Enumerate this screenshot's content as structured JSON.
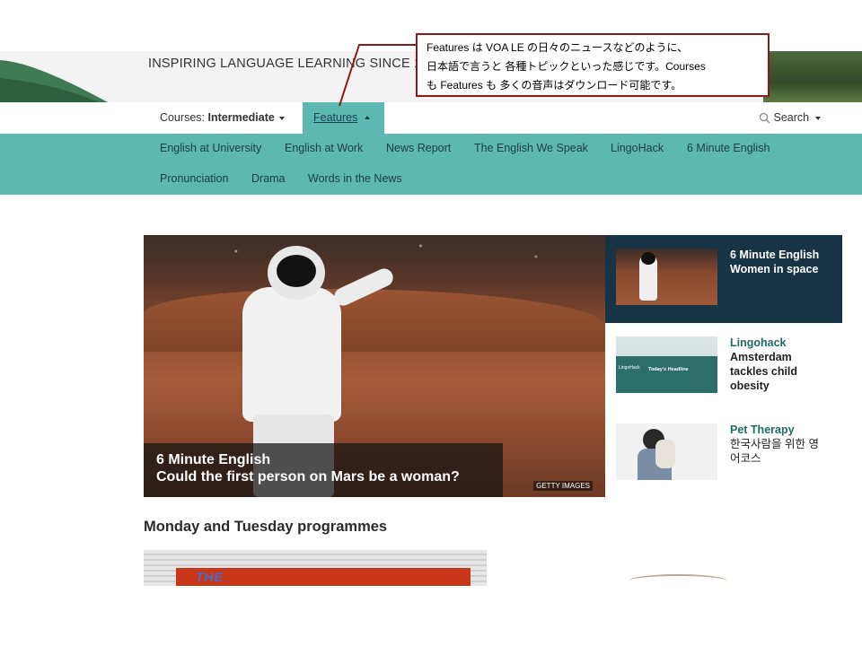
{
  "banner": {
    "tagline": "INSPIRING LANGUAGE LEARNING SINCE 1"
  },
  "nav": {
    "courses_label": "Courses:",
    "courses_value": "Intermediate",
    "features_label": "Features",
    "search_label": "Search"
  },
  "submenu": {
    "items": [
      "English at University",
      "English at Work",
      "News Report",
      "The English We Speak",
      "LingoHack",
      "6 Minute English",
      "Pronunciation",
      "Drama",
      "Words in the News"
    ]
  },
  "hero": {
    "series": "6 Minute English",
    "title": "Could the first person on Mars be a woman?",
    "credit": "GETTY IMAGES"
  },
  "cards": [
    {
      "series": "6 Minute English",
      "title": "Women in space"
    },
    {
      "series": "Lingohack",
      "title_lines": [
        "Amsterdam",
        "tackles child",
        "obesity"
      ],
      "thumb_text": "Today's Headline",
      "thumb_logo": "LingoHack"
    },
    {
      "series": "Pet Therapy",
      "title_lines": [
        "한국사람을 위한 영",
        "어코스"
      ]
    }
  ],
  "section": {
    "title": "Monday and Tuesday programmes"
  },
  "promo": {
    "text": "THE"
  },
  "annotation": {
    "lines": [
      "Features は VOA LE の日々のニュースなどのように、",
      "日本語で言うと 各種トピックといった感じです。Courses",
      "も Features も 多くの音声はダウンロード可能です。"
    ]
  },
  "colors": {
    "teal": "#5eb8b2",
    "navy": "#173447",
    "callout_border": "#8b1a1a"
  }
}
